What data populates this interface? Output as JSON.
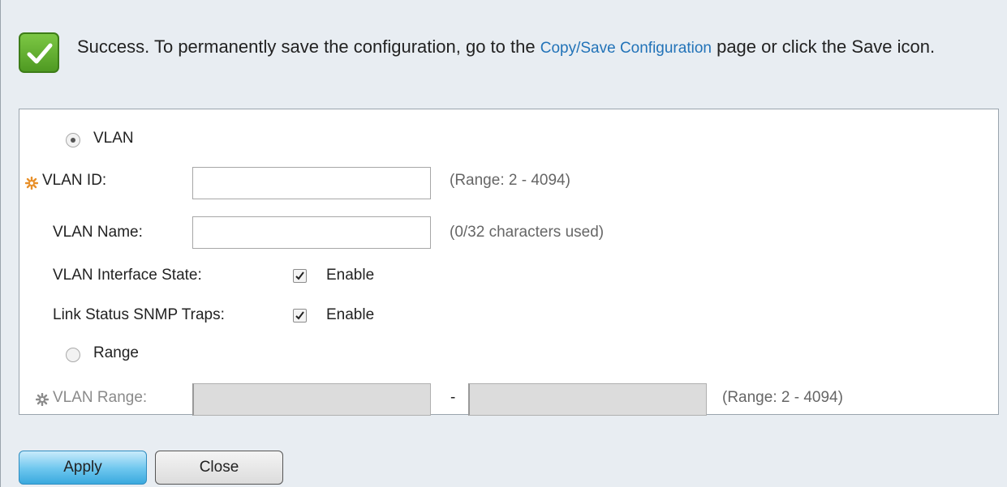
{
  "banner": {
    "text_before": "Success. To permanently save the configuration, go to the ",
    "link": "Copy/Save Configuration",
    "text_after": " page or click the Save icon."
  },
  "form": {
    "vlan_radio_label": "VLAN",
    "vlan_id_label": "VLAN ID:",
    "vlan_id_value": "",
    "vlan_id_hint": "(Range: 2 - 4094)",
    "vlan_name_label": "VLAN Name:",
    "vlan_name_value": "",
    "vlan_name_hint": "(0/32 characters used)",
    "interface_state_label": "VLAN Interface State:",
    "interface_state_option": "Enable",
    "snmp_traps_label": "Link Status SNMP Traps:",
    "snmp_traps_option": "Enable",
    "range_radio_label": "Range",
    "vlan_range_label": "VLAN Range:",
    "vlan_range_separator": "-",
    "vlan_range_from": "",
    "vlan_range_to": "",
    "vlan_range_hint": "(Range: 2 - 4094)"
  },
  "buttons": {
    "apply": "Apply",
    "close": "Close"
  },
  "state": {
    "selected_mode": "VLAN",
    "interface_state_checked": true,
    "snmp_traps_checked": true
  },
  "colors": {
    "success_green": "#5aaa2c",
    "link_blue": "#2273b8",
    "required_orange": "#e8902a",
    "apply_blue": "#6cc6ee"
  }
}
